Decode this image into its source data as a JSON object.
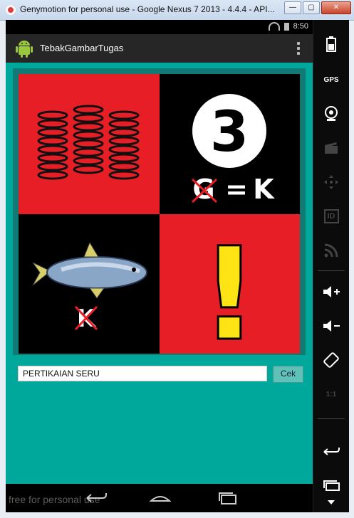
{
  "window": {
    "title": "Genymotion for personal use - Google Nexus 7 2013 - 4.4.4 - API...",
    "buttons": {
      "minimize": "—",
      "maximize": "▢",
      "close": "✕"
    }
  },
  "statusbar": {
    "time": "8:50"
  },
  "app": {
    "title": "TebakGambarTugas"
  },
  "puzzle": {
    "tile2": {
      "number": "3",
      "rule_from": "G",
      "rule_eq": "=",
      "rule_to": "K"
    },
    "tile3": {
      "struck_letter": "K"
    },
    "tile4": {
      "symbol": "!"
    }
  },
  "form": {
    "answer_value": "PERTIKAIAN SERU",
    "check_label": "Cek"
  },
  "navbar": {
    "watermark": "free for personal use"
  },
  "sidepanel": {
    "gps_label": "GPS",
    "id_label": "ID",
    "pixel_label": "1:1"
  },
  "colors": {
    "accent": "#00a89c",
    "red": "#e71e25",
    "yellow": "#ffe415"
  }
}
